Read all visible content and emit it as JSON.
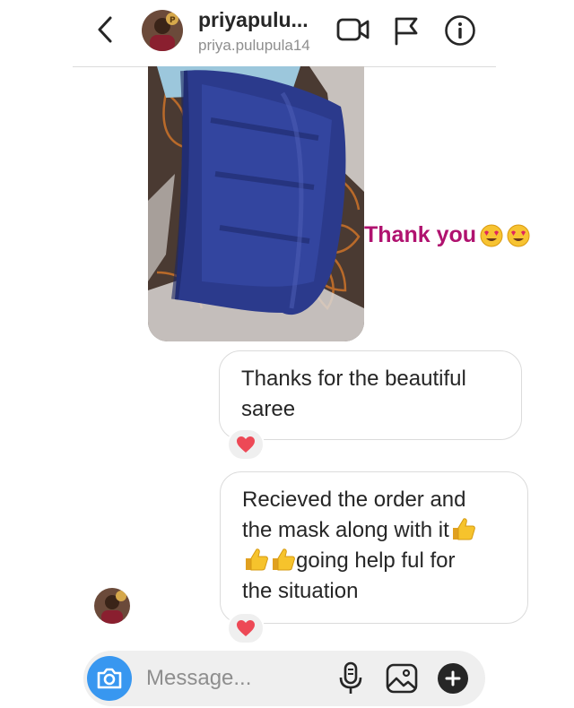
{
  "header": {
    "username": "priyapulu...",
    "handle": "priya.pulupula14",
    "back_icon": "chevron-left-icon",
    "actions": [
      "video-camera-icon",
      "flag-icon",
      "info-icon"
    ]
  },
  "conversation": {
    "overlay_note": "Thank you",
    "overlay_emojis": [
      "heart-eyes-emoji",
      "heart-eyes-emoji"
    ],
    "messages": [
      {
        "lines": [
          "Thanks for the beautiful",
          "saree"
        ],
        "reaction": "heart-icon"
      },
      {
        "lines": [
          "Recieved the order and",
          "the mask along with it",
          "going help ful for",
          "the situation"
        ],
        "inline_emojis": [
          "thumbs-up-emoji",
          "thumbs-up-emoji",
          "thumbs-up-emoji"
        ],
        "reaction": "heart-icon"
      }
    ]
  },
  "composer": {
    "placeholder": "Message...",
    "icons": [
      "camera-icon",
      "microphone-icon",
      "gallery-icon",
      "plus-icon"
    ]
  },
  "colors": {
    "accent_blue": "#3897f0",
    "note_magenta": "#b0126f",
    "heart_red": "#ed4956",
    "border": "#dbdbdb",
    "muted": "#8e8e8e"
  }
}
